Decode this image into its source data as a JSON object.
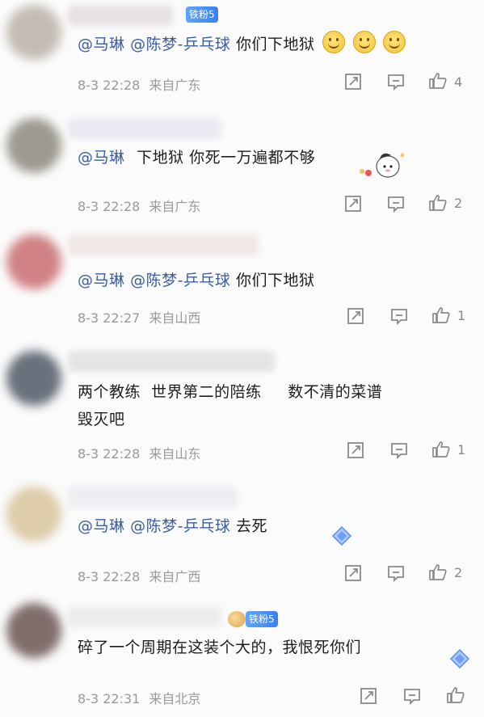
{
  "comments": [
    {
      "mentions": [
        "@马琳",
        "@陈梦-乒乓球"
      ],
      "text": "你们下地狱",
      "time": "8-3 22:28",
      "location": "来自广东",
      "likes": "4",
      "fan_badge": "铁粉5",
      "emoji": [
        "smile-emoji",
        "smile-emoji",
        "smile-emoji"
      ]
    },
    {
      "mentions": [
        "@马琳"
      ],
      "text": "下地狱 你死一万遍都不够",
      "time": "8-3 22:28",
      "location": "来自广东",
      "likes": "2"
    },
    {
      "mentions": [
        "@马琳",
        "@陈梦-乒乓球"
      ],
      "text": "你们下地狱",
      "time": "8-3 22:27",
      "location": "来自山西",
      "likes": "1"
    },
    {
      "line1": "两个教练  世界第二的陪练     数不清的菜谱",
      "line2": "毁灭吧",
      "time": "8-3 22:28",
      "location": "来自山东",
      "likes": "1"
    },
    {
      "mentions": [
        "@马琳",
        "@陈梦-乒乓球"
      ],
      "text": "去死",
      "time": "8-3 22:28",
      "location": "来自广西",
      "likes": "2"
    },
    {
      "text": "碎了一个周期在这装个大的，我恨死你们",
      "time": "8-3 22:31",
      "location": "来自北京",
      "likes": "",
      "fan_badge": "铁粉5"
    }
  ],
  "colors": {
    "mention": "#3a5d9f",
    "meta": "#9a9a9a",
    "icon": "#8a8a8a",
    "badge": "#4a8cf5"
  }
}
